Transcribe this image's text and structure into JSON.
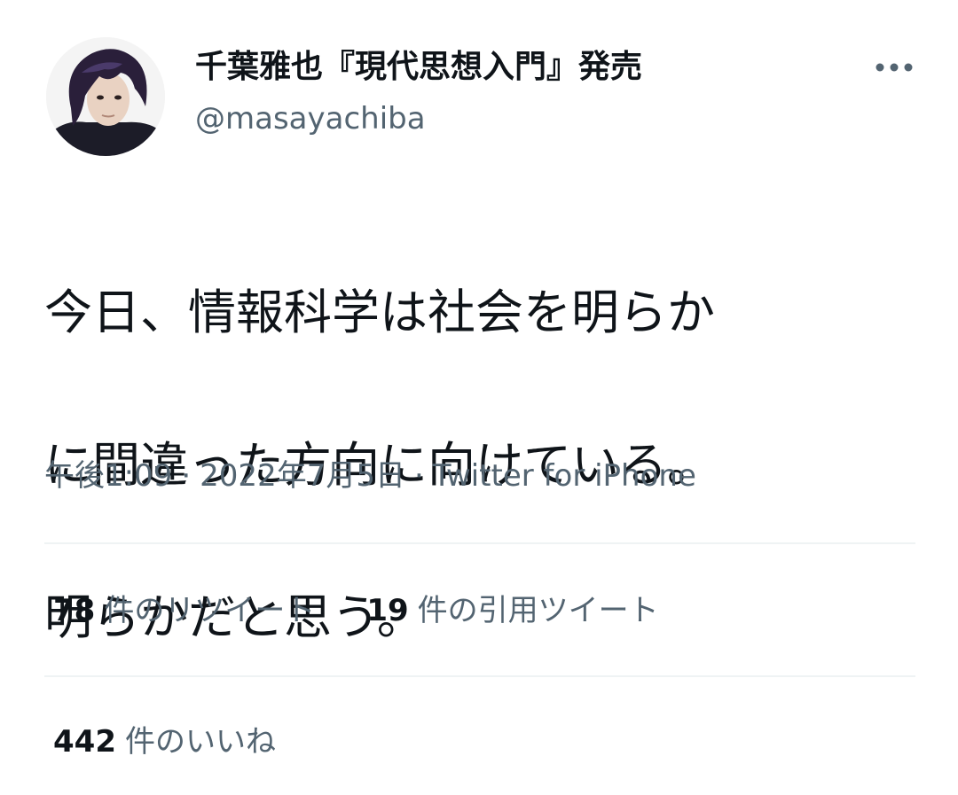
{
  "tweet": {
    "author": {
      "display_name": "千葉雅也『現代思想入門』発売",
      "handle": "@masayachiba"
    },
    "text_lines": [
      "今日、情報科学は社会を明らか",
      "に間違った方向に向けている。",
      "明らかだと思う。"
    ],
    "meta": {
      "time": "午後1:09",
      "date": "2022年7月5日",
      "separator": "·",
      "source": "Twitter for iPhone"
    },
    "stats": {
      "retweets": {
        "count": "78",
        "label": "件のリツイート"
      },
      "quotes": {
        "count": "19",
        "label": "件の引用ツイート"
      },
      "likes": {
        "count": "442",
        "label": "件のいいね"
      }
    }
  },
  "icons": {
    "more": "more-horizontal-icon"
  },
  "colors": {
    "primary_text": "#0f1419",
    "secondary_text": "#536471",
    "divider": "#eff3f4",
    "background": "#ffffff"
  }
}
